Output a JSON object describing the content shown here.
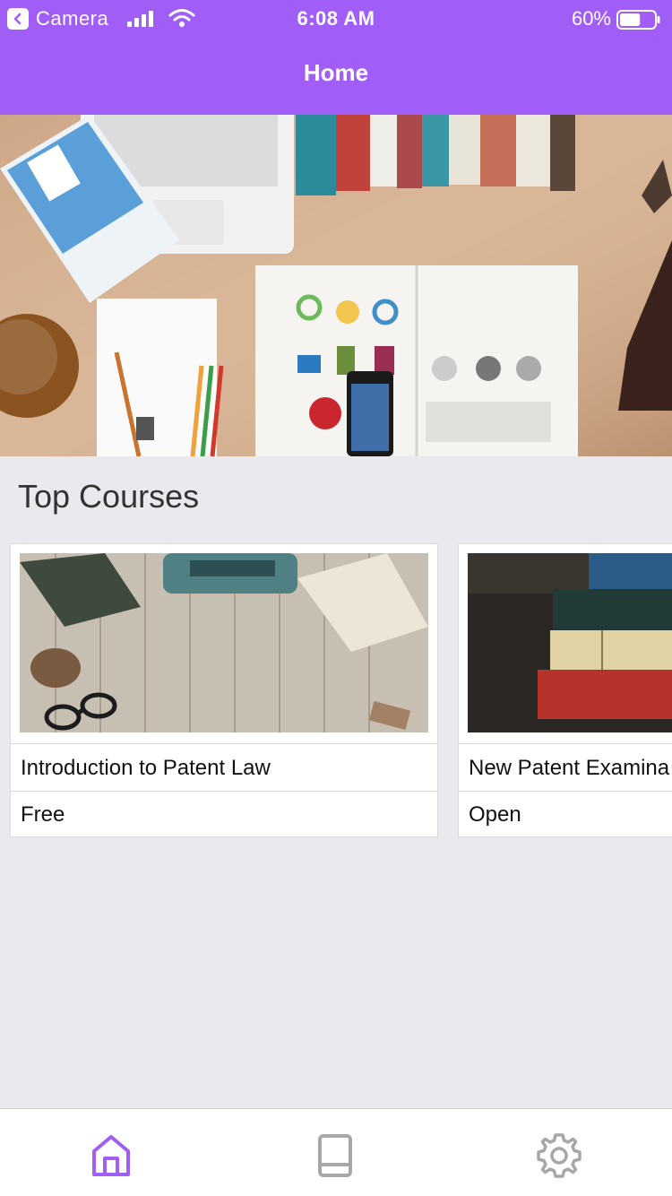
{
  "status_bar": {
    "back_label": "Camera",
    "time": "6:08 AM",
    "battery": "60%",
    "battery_level": 0.6
  },
  "header": {
    "title": "Home"
  },
  "hero": {
    "slide_count": 2,
    "active_slide": 1
  },
  "section": {
    "title": "Top Courses"
  },
  "courses": [
    {
      "title": "Introduction to Patent Law",
      "price": "Free"
    },
    {
      "title": "New Patent Examina",
      "price": "Open"
    }
  ],
  "tabbar": {
    "items": [
      {
        "icon": "home-icon",
        "active": true
      },
      {
        "icon": "book-icon",
        "active": false
      },
      {
        "icon": "gear-icon",
        "active": false
      }
    ]
  },
  "colors": {
    "accent": "#a05ef7",
    "background": "#eae9ee",
    "inactive_icon": "#a7a7a7"
  }
}
